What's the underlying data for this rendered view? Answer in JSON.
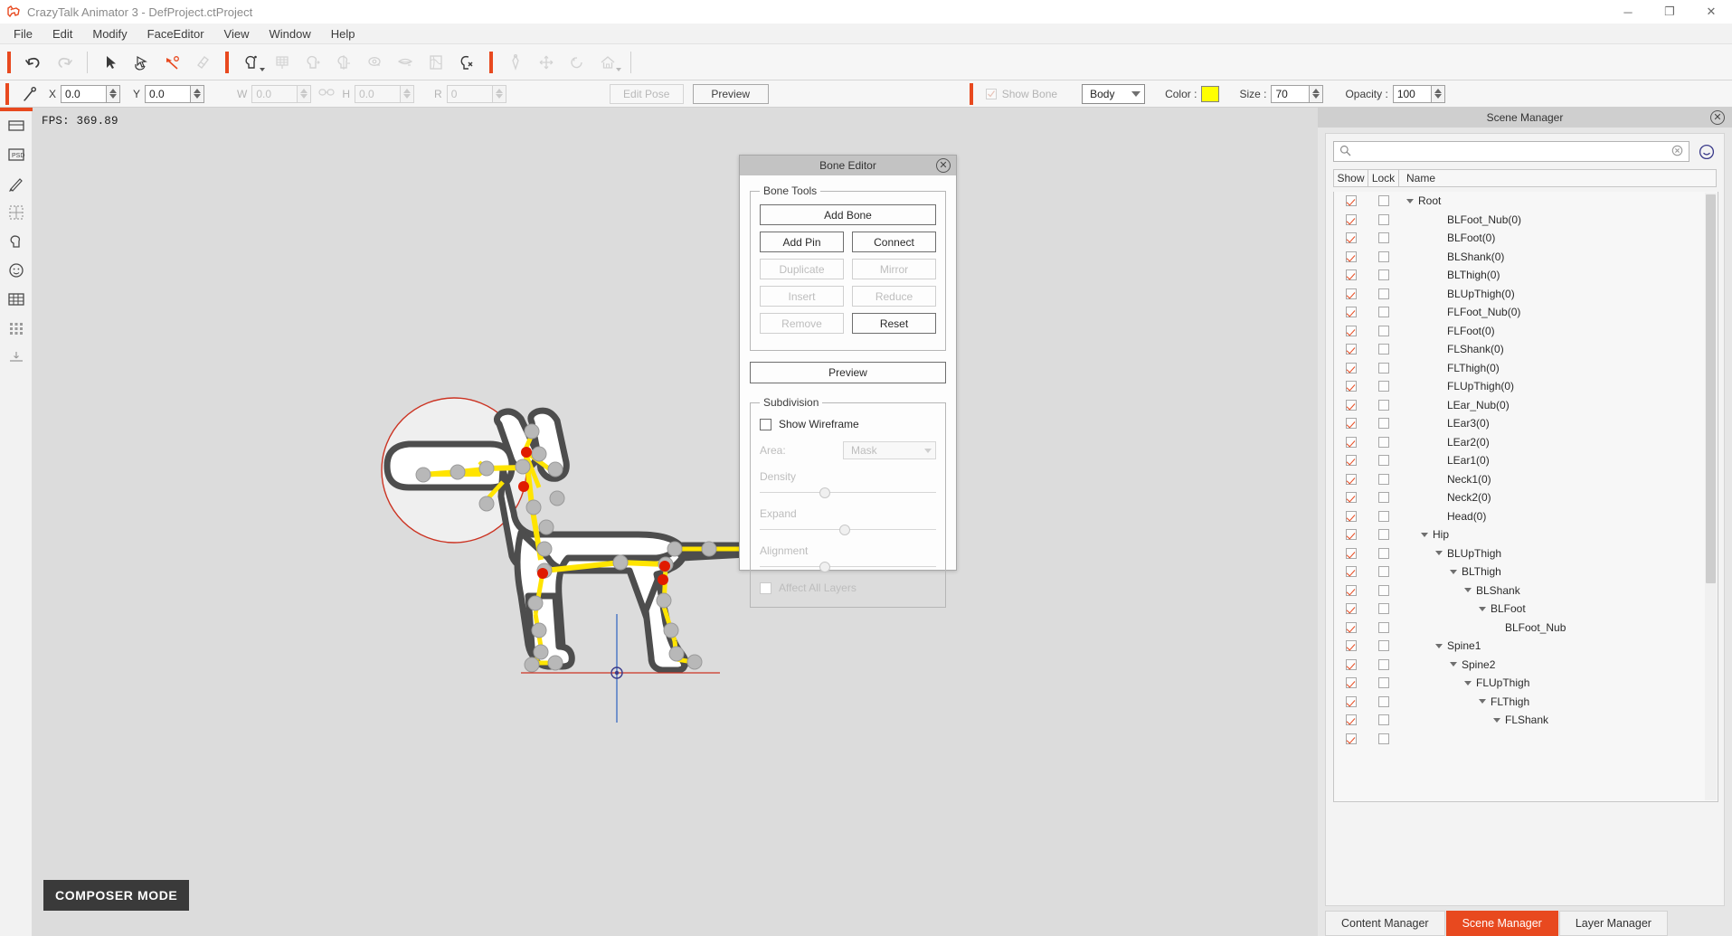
{
  "window": {
    "title": "CrazyTalk Animator 3   - DefProject.ctProject",
    "minimize": "─",
    "maximize": "❐",
    "close": "✕"
  },
  "menu": {
    "items": [
      "File",
      "Edit",
      "Modify",
      "FaceEditor",
      "View",
      "Window",
      "Help"
    ]
  },
  "toolbar": {
    "groups": [
      {
        "icons": [
          {
            "name": "undo-icon",
            "disabled": false
          },
          {
            "name": "redo-icon",
            "disabled": true
          }
        ]
      },
      {
        "icons": [
          {
            "name": "select-arrow-icon",
            "disabled": false
          },
          {
            "name": "transform-hand-icon",
            "disabled": false
          },
          {
            "name": "sprite-editor-pen-icon",
            "disabled": false
          },
          {
            "name": "eraser-icon",
            "disabled": true
          }
        ]
      },
      {
        "icons": [
          {
            "name": "head-dropdown-icon",
            "disabled": false,
            "caret": true
          },
          {
            "name": "grid-sprite-icon",
            "disabled": true
          },
          {
            "name": "face-fitting-icon",
            "disabled": true
          },
          {
            "name": "head-angle-icon",
            "disabled": true
          },
          {
            "name": "eye-icon",
            "disabled": true
          },
          {
            "name": "mouth-icon",
            "disabled": true
          },
          {
            "name": "texture-map-icon",
            "disabled": true
          },
          {
            "name": "head-remove-icon",
            "disabled": false
          }
        ]
      },
      {
        "icons": [
          {
            "name": "bone-icon",
            "disabled": true
          },
          {
            "name": "move-icon",
            "disabled": true
          },
          {
            "name": "rotate-icon",
            "disabled": true
          },
          {
            "name": "home-icon",
            "disabled": true,
            "caret": true
          }
        ]
      }
    ]
  },
  "propbar": {
    "tool_icon": "bone-pick-icon",
    "fields": [
      {
        "label": "X",
        "value": "0.0",
        "disabled": false
      },
      {
        "label": "Y",
        "value": "0.0",
        "disabled": false
      },
      {
        "label": "W",
        "value": "0.0",
        "disabled": true
      },
      {
        "label": "H",
        "value": "0.0",
        "disabled": true
      },
      {
        "label": "R",
        "value": "0",
        "disabled": true
      }
    ],
    "link_icon": "link-icon",
    "edit_pose_label": "Edit Pose",
    "preview_label": "Preview",
    "show_bone_label": "Show Bone",
    "show_bone_checked": true,
    "body_combo_value": "Body",
    "color_label": "Color :",
    "color_value": "#ffff00",
    "size_label": "Size :",
    "size_value": "70",
    "opacity_label": "Opacity :",
    "opacity_value": "100"
  },
  "leftrail": {
    "items": [
      {
        "name": "rail-item-sprite"
      },
      {
        "name": "rail-item-psd"
      },
      {
        "name": "rail-item-pen"
      },
      {
        "name": "rail-item-mesh"
      },
      {
        "name": "rail-item-head"
      },
      {
        "name": "rail-item-face"
      },
      {
        "name": "rail-item-layers"
      },
      {
        "name": "rail-item-dots"
      },
      {
        "name": "rail-item-align"
      }
    ]
  },
  "viewport": {
    "fps": "FPS: 369.89",
    "composer_mode": "COMPOSER MODE"
  },
  "bone_editor": {
    "title": "Bone Editor",
    "close": "✕",
    "bone_tools_legend": "Bone Tools",
    "add_bone": "Add Bone",
    "add_pin": "Add Pin",
    "connect": "Connect",
    "duplicate": "Duplicate",
    "mirror": "Mirror",
    "insert": "Insert",
    "reduce": "Reduce",
    "remove": "Remove",
    "reset": "Reset",
    "preview": "Preview",
    "subdivision_legend": "Subdivision",
    "show_wireframe": "Show Wireframe",
    "show_wireframe_checked": false,
    "area_label": "Area:",
    "area_value": "Mask",
    "density_label": "Density",
    "density_pct": 34,
    "expand_label": "Expand",
    "expand_pct": 45,
    "alignment_label": "Alignment",
    "alignment_pct": 34,
    "affect_all_layers": "Affect All  Layers",
    "affect_all_checked": false
  },
  "scene_manager": {
    "title": "Scene Manager",
    "close": "✕",
    "search_placeholder": "",
    "search_icon": "search-icon",
    "clear_icon": "clear-icon",
    "smile_icon": "smile-icon",
    "columns": [
      "Show",
      "Lock",
      "Name"
    ],
    "rows": [
      {
        "label": "Root",
        "indent": 0,
        "twisty": true,
        "show": true,
        "lock": false
      },
      {
        "label": "BLFoot_Nub(0)",
        "indent": 2,
        "twisty": false,
        "show": true,
        "lock": false
      },
      {
        "label": "BLFoot(0)",
        "indent": 2,
        "twisty": false,
        "show": true,
        "lock": false
      },
      {
        "label": "BLShank(0)",
        "indent": 2,
        "twisty": false,
        "show": true,
        "lock": false
      },
      {
        "label": "BLThigh(0)",
        "indent": 2,
        "twisty": false,
        "show": true,
        "lock": false
      },
      {
        "label": "BLUpThigh(0)",
        "indent": 2,
        "twisty": false,
        "show": true,
        "lock": false
      },
      {
        "label": "FLFoot_Nub(0)",
        "indent": 2,
        "twisty": false,
        "show": true,
        "lock": false
      },
      {
        "label": "FLFoot(0)",
        "indent": 2,
        "twisty": false,
        "show": true,
        "lock": false
      },
      {
        "label": "FLShank(0)",
        "indent": 2,
        "twisty": false,
        "show": true,
        "lock": false
      },
      {
        "label": "FLThigh(0)",
        "indent": 2,
        "twisty": false,
        "show": true,
        "lock": false
      },
      {
        "label": "FLUpThigh(0)",
        "indent": 2,
        "twisty": false,
        "show": true,
        "lock": false
      },
      {
        "label": "LEar_Nub(0)",
        "indent": 2,
        "twisty": false,
        "show": true,
        "lock": false
      },
      {
        "label": "LEar3(0)",
        "indent": 2,
        "twisty": false,
        "show": true,
        "lock": false
      },
      {
        "label": "LEar2(0)",
        "indent": 2,
        "twisty": false,
        "show": true,
        "lock": false
      },
      {
        "label": "LEar1(0)",
        "indent": 2,
        "twisty": false,
        "show": true,
        "lock": false
      },
      {
        "label": "Neck1(0)",
        "indent": 2,
        "twisty": false,
        "show": true,
        "lock": false
      },
      {
        "label": "Neck2(0)",
        "indent": 2,
        "twisty": false,
        "show": true,
        "lock": false
      },
      {
        "label": "Head(0)",
        "indent": 2,
        "twisty": false,
        "show": true,
        "lock": false
      },
      {
        "label": "Hip",
        "indent": 1,
        "twisty": true,
        "show": true,
        "lock": false
      },
      {
        "label": "BLUpThigh",
        "indent": 2,
        "twisty": true,
        "show": true,
        "lock": false
      },
      {
        "label": "BLThigh",
        "indent": 3,
        "twisty": true,
        "show": true,
        "lock": false
      },
      {
        "label": "BLShank",
        "indent": 4,
        "twisty": true,
        "show": true,
        "lock": false
      },
      {
        "label": "BLFoot",
        "indent": 5,
        "twisty": true,
        "show": true,
        "lock": false
      },
      {
        "label": "BLFoot_Nub",
        "indent": 6,
        "twisty": false,
        "show": true,
        "lock": false
      },
      {
        "label": "Spine1",
        "indent": 2,
        "twisty": true,
        "show": true,
        "lock": false
      },
      {
        "label": "Spine2",
        "indent": 3,
        "twisty": true,
        "show": true,
        "lock": false
      },
      {
        "label": "FLUpThigh",
        "indent": 4,
        "twisty": true,
        "show": true,
        "lock": false
      },
      {
        "label": "FLThigh",
        "indent": 5,
        "twisty": true,
        "show": true,
        "lock": false
      },
      {
        "label": "FLShank",
        "indent": 6,
        "twisty": true,
        "show": true,
        "lock": false
      },
      {
        "label": "",
        "indent": 6,
        "twisty": false,
        "show": true,
        "lock": false
      }
    ],
    "tabs": [
      {
        "label": "Content Manager",
        "active": false
      },
      {
        "label": "Scene Manager",
        "active": true
      },
      {
        "label": "Layer Manager",
        "active": false
      }
    ]
  }
}
